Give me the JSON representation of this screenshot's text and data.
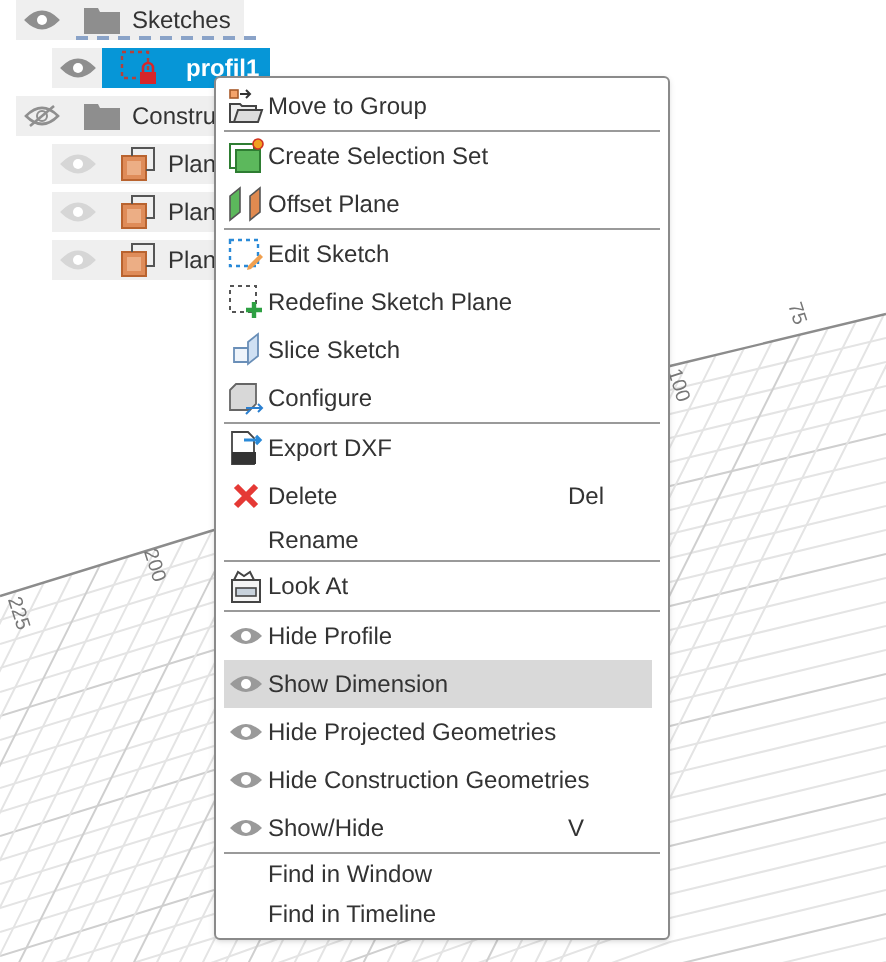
{
  "browser": {
    "nodes": [
      {
        "kind": "folder",
        "label": "Sketches",
        "visible": true,
        "selected": false,
        "children": [
          {
            "kind": "sketch",
            "label": "profil1",
            "visible": true,
            "selected": true
          }
        ]
      },
      {
        "kind": "folder",
        "label": "Constru",
        "visible": false,
        "selected": false,
        "children": [
          {
            "kind": "plane",
            "label": "Plan",
            "visible": true,
            "selected": false
          },
          {
            "kind": "plane",
            "label": "Plan",
            "visible": true,
            "selected": false
          },
          {
            "kind": "plane",
            "label": "Plan",
            "visible": true,
            "selected": false
          }
        ]
      }
    ]
  },
  "viewport": {
    "grid_labels": [
      "75",
      "100",
      "200",
      "225"
    ]
  },
  "context_menu": {
    "groups": [
      [
        {
          "label": "Move to Group",
          "selected": false
        }
      ],
      [
        {
          "label": "Create Selection Set",
          "selected": false
        },
        {
          "label": "Offset Plane",
          "selected": false
        }
      ],
      [
        {
          "label": "Edit Sketch",
          "selected": false
        },
        {
          "label": "Redefine Sketch Plane",
          "selected": false
        },
        {
          "label": "Slice Sketch",
          "selected": false
        },
        {
          "label": "Configure",
          "selected": false
        }
      ],
      [
        {
          "label": "Export DXF",
          "selected": false
        },
        {
          "label": "Delete",
          "shortcut": "Del",
          "selected": false
        },
        {
          "label": "Rename",
          "selected": false
        }
      ],
      [
        {
          "label": "Look At",
          "selected": false
        }
      ],
      [
        {
          "label": "Hide Profile",
          "selected": false
        },
        {
          "label": "Show Dimension",
          "selected": true
        },
        {
          "label": "Hide Projected Geometries",
          "selected": false
        },
        {
          "label": "Hide Construction Geometries",
          "selected": false
        },
        {
          "label": "Show/Hide",
          "shortcut": "V",
          "selected": false
        }
      ],
      [
        {
          "label": "Find in Window",
          "selected": false
        },
        {
          "label": "Find in Timeline",
          "selected": false
        }
      ]
    ]
  }
}
